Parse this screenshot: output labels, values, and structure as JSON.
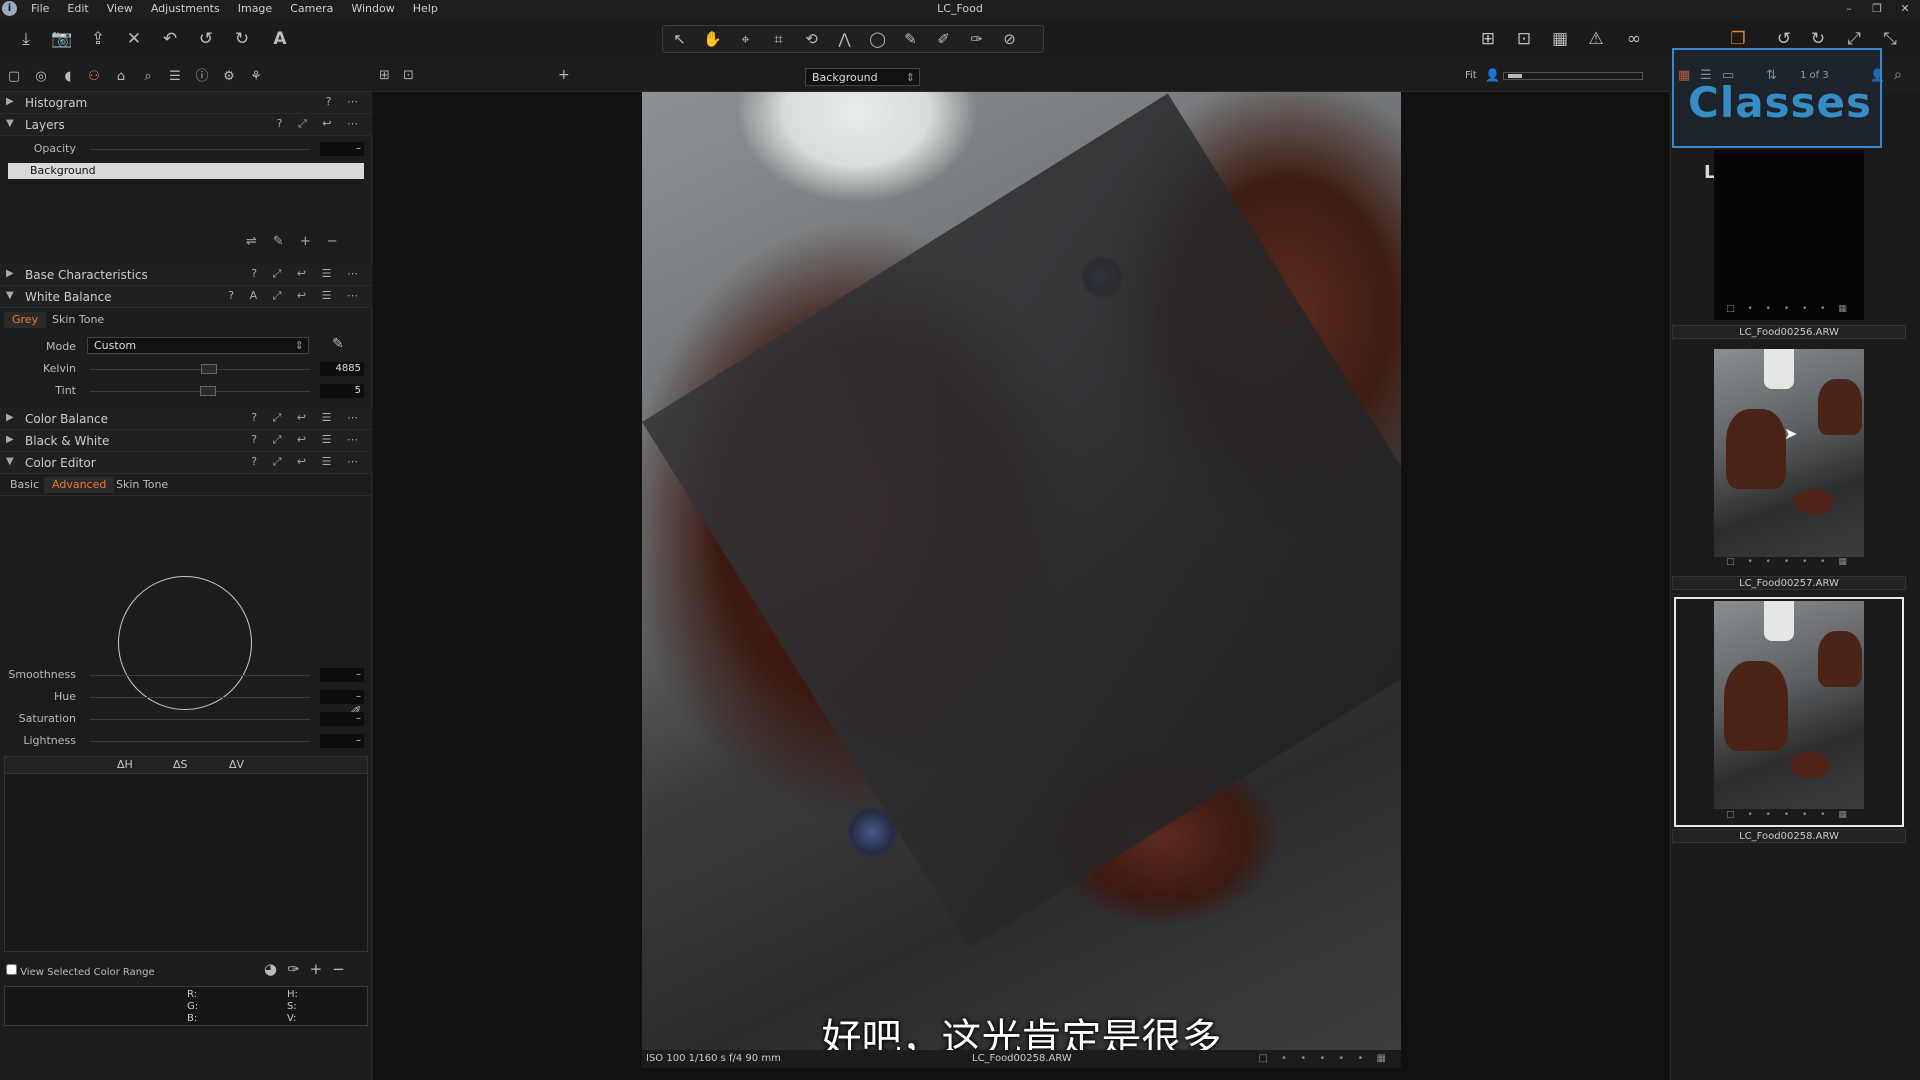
{
  "window": {
    "title": "LC_Food",
    "controls": [
      "–",
      "❐",
      "✕"
    ]
  },
  "menu": [
    "File",
    "Edit",
    "View",
    "Adjustments",
    "Image",
    "Camera",
    "Window",
    "Help"
  ],
  "app_logo_letter": "i",
  "toolbar": {
    "left_icons": [
      "import-icon",
      "capture-icon",
      "process-icon",
      "delete-icon",
      "undo-all-icon",
      "undo-icon",
      "redo-icon",
      "text-icon"
    ],
    "left_glyphs": [
      "⤓",
      "📷",
      "⇪",
      "✕",
      "↶",
      "↺",
      "↻",
      "A"
    ],
    "cursor_tools": [
      "select",
      "pan",
      "loupe",
      "crop",
      "rotate",
      "keystone",
      "spot",
      "brush",
      "picker",
      "eraser",
      "gradient"
    ],
    "cursor_glyphs": [
      "↖",
      "✋",
      "⌖",
      "⌗",
      "⟲",
      "⋀",
      "◯",
      "✎",
      "✐",
      "✑",
      "⊘"
    ],
    "right_glyphs": [
      "⊞",
      "⊡",
      "▦",
      "⚠",
      "∞"
    ],
    "far_right_glyphs": [
      "❐",
      "↺",
      "↻",
      "⤢",
      "⤡"
    ]
  },
  "tool_tabs_glyphs": [
    "▢",
    "◎",
    "◖",
    "⚇",
    "⌂",
    "⌕",
    "☰",
    "ⓘ",
    "⚙",
    "⚘"
  ],
  "panels": {
    "histogram": {
      "title": "Histogram",
      "icons": "? ⋯"
    },
    "layers": {
      "title": "Layers",
      "icons": "? ⤢ ↩ ⋯",
      "opacity_label": "Opacity",
      "opacity_value": "–",
      "items": [
        "Background"
      ],
      "action_icons": [
        "⇌",
        "✎",
        "+",
        "−"
      ]
    },
    "base_characteristics": {
      "title": "Base Characteristics",
      "icons": "? ⤢ ↩ ☰ ⋯"
    },
    "white_balance": {
      "title": "White Balance",
      "icons": "? A ⤢ ↩ ☰ ⋯",
      "tabs": [
        "Grey",
        "Skin Tone"
      ],
      "mode_label": "Mode",
      "mode_value": "Custom",
      "kelvin_label": "Kelvin",
      "kelvin_value": "4885",
      "tint_label": "Tint",
      "tint_value": "5"
    },
    "color_balance": {
      "title": "Color Balance",
      "icons": "? ⤢ ↩ ☰ ⋯"
    },
    "black_white": {
      "title": "Black & White",
      "icons": "? ⤢ ↩ ☰ ⋯"
    },
    "color_editor": {
      "title": "Color Editor",
      "icons": "? ⤢ ↩ ☰ ⋯",
      "tabs": [
        "Basic",
        "Advanced",
        "Skin Tone"
      ],
      "sliders": [
        {
          "label": "Smoothness",
          "value": "–"
        },
        {
          "label": "Hue",
          "value": "–"
        },
        {
          "label": "Saturation",
          "value": "–"
        },
        {
          "label": "Lightness",
          "value": "–"
        }
      ],
      "columns": [
        "ΔH",
        "ΔS",
        "ΔV"
      ],
      "view_range_label": "View Selected Color Range",
      "readout": {
        "r": "R:",
        "g": "G:",
        "b": "B:",
        "h": "H:",
        "s": "S:",
        "v": "V:"
      }
    }
  },
  "viewer": {
    "variant": "Background",
    "fit_label": "Fit",
    "subtitle": "好吧，这光肯定是很多",
    "exif": "ISO 100  1/160 s  f/4  90 mm",
    "filename": "LC_Food00258.ARW"
  },
  "browser": {
    "counter": "1 of 3",
    "watermark": "Classes",
    "watermark_site": "LiveClasses.ru",
    "thumbs": [
      {
        "name": "LC_Food00256.ARW",
        "selected": false
      },
      {
        "name": "LC_Food00257.ARW",
        "selected": false
      },
      {
        "name": "LC_Food00258.ARW",
        "selected": true
      }
    ]
  },
  "colors": {
    "accent": "#f07a2a",
    "panel": "#1c1c1c",
    "selection": "#d9d9d9"
  }
}
